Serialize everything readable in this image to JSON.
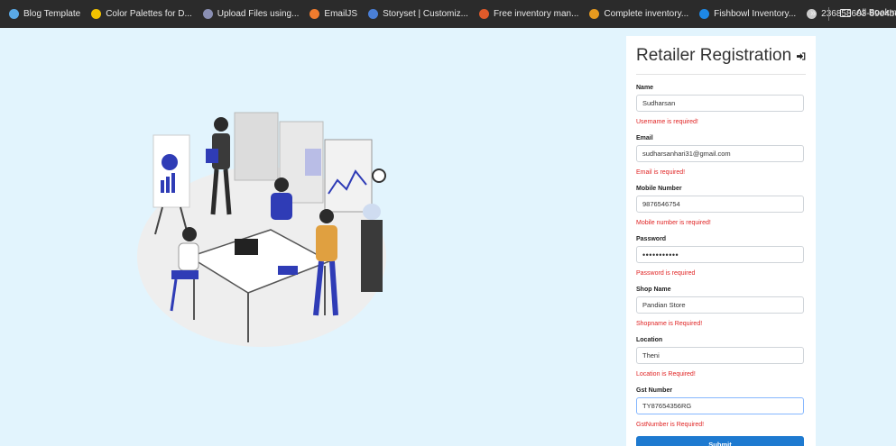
{
  "bookmarks": [
    {
      "label": "Blog Template",
      "color": "#5aa9e6"
    },
    {
      "label": "Color Palettes for D...",
      "color": "#f2c200"
    },
    {
      "label": "Upload Files using...",
      "color": "#8a8fb3"
    },
    {
      "label": "EmailJS",
      "color": "#f07c2e"
    },
    {
      "label": "Storyset | Customiz...",
      "color": "#4a7fd6"
    },
    {
      "label": "Free inventory man...",
      "color": "#e05a2a"
    },
    {
      "label": "Complete inventory...",
      "color": "#e69a1f"
    },
    {
      "label": "Fishbowl Inventory...",
      "color": "#1e88e5"
    },
    {
      "label": "236858603-89e4be...",
      "color": "#cccccc"
    }
  ],
  "bookmarks_more": "»",
  "all_bookmarks": "All Bookmarks",
  "form": {
    "title": "Retailer Registration",
    "fields": [
      {
        "label": "Name",
        "value": "Sudharsan",
        "error": "Username is required!"
      },
      {
        "label": "Email",
        "value": "sudharsanhari31@gmail.com",
        "error": "Email is required!"
      },
      {
        "label": "Mobile Number",
        "value": "9876546754",
        "error": "Mobile number is required!"
      },
      {
        "label": "Password",
        "value": "•••••••••••",
        "error": "Password is required"
      },
      {
        "label": "Shop Name",
        "value": "Pandian Store",
        "error": "Shopname is Required!"
      },
      {
        "label": "Location",
        "value": "Theni",
        "error": "Location is Required!"
      },
      {
        "label": "Gst Number",
        "value": "TY87654356RG",
        "error": "GstNumber is Required!"
      }
    ],
    "submit": "Submit"
  },
  "colors": {
    "background": "#e2f4fd",
    "accent": "#1e7ad0",
    "error": "#e02424",
    "illustration": "#2f3cb6"
  }
}
